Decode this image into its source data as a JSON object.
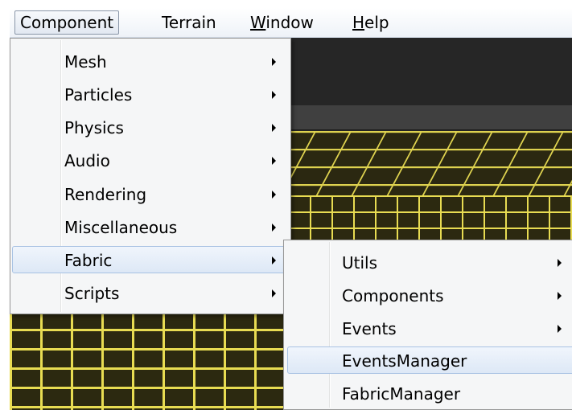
{
  "menubar": {
    "items": [
      {
        "pre": "",
        "accel": "",
        "post": "Component"
      },
      {
        "pre": "",
        "accel": "",
        "post": "Terrain"
      },
      {
        "pre": "",
        "accel": "W",
        "post": "indow"
      },
      {
        "pre": "",
        "accel": "H",
        "post": "elp"
      }
    ]
  },
  "component_menu": {
    "items": [
      {
        "label": "Mesh"
      },
      {
        "label": "Particles"
      },
      {
        "label": "Physics"
      },
      {
        "label": "Audio"
      },
      {
        "label": "Rendering"
      },
      {
        "label": "Miscellaneous"
      },
      {
        "label": "Fabric"
      },
      {
        "label": "Scripts"
      }
    ],
    "highlighted": "Fabric"
  },
  "fabric_menu": {
    "items": [
      {
        "label": "Utils"
      },
      {
        "label": "Components"
      },
      {
        "label": "Events"
      },
      {
        "label": "EventsManager"
      },
      {
        "label": "FabricManager"
      }
    ],
    "highlighted": "EventsManager"
  },
  "colors": {
    "menu_bg": "#f5f6f7",
    "highlight_bg": "#dde8f6",
    "highlight_border": "#a8c2e3",
    "viewport_bg": "#262626",
    "grid_line": "#e8dc52"
  }
}
